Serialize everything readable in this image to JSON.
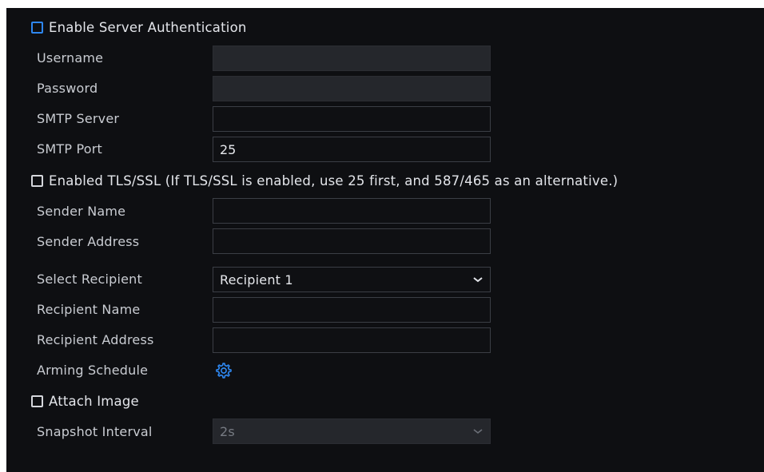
{
  "server_auth": {
    "label": "Enable Server Authentication",
    "checked": false
  },
  "username": {
    "label": "Username",
    "value": ""
  },
  "password": {
    "label": "Password",
    "value": ""
  },
  "smtp_server": {
    "label": "SMTP Server",
    "value": ""
  },
  "smtp_port": {
    "label": "SMTP Port",
    "value": "25"
  },
  "tls": {
    "label": "Enabled TLS/SSL (If TLS/SSL is enabled, use 25 first, and 587/465 as an alternative.)",
    "checked": false
  },
  "sender_name": {
    "label": "Sender Name",
    "value": ""
  },
  "sender_address": {
    "label": "Sender Address",
    "value": ""
  },
  "select_recipient": {
    "label": "Select Recipient",
    "value": "Recipient 1"
  },
  "recipient_name": {
    "label": "Recipient Name",
    "value": ""
  },
  "recipient_address": {
    "label": "Recipient Address",
    "value": ""
  },
  "arming_schedule": {
    "label": "Arming Schedule",
    "icon": "gear-icon",
    "icon_color": "#2e87f0"
  },
  "attach_image": {
    "label": "Attach Image",
    "checked": false
  },
  "snapshot_interval": {
    "label": "Snapshot Interval",
    "value": "2s"
  },
  "colors": {
    "background": "#0e0f12",
    "accent": "#2e87f0",
    "field_border": "#3b3e45",
    "disabled_field": "#25272c"
  }
}
